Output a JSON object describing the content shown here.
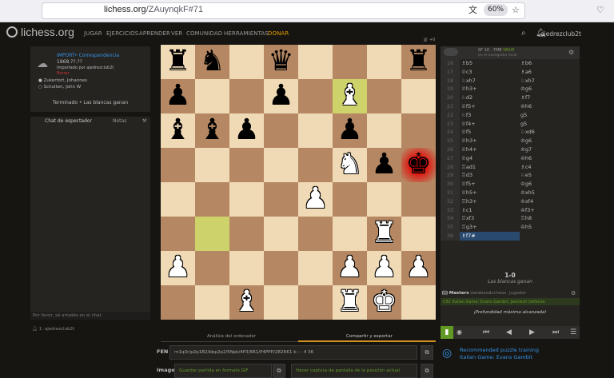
{
  "browser": {
    "url_domain": "lichess.org",
    "url_path": "/ZAuynqkF#71",
    "zoom": "60%"
  },
  "header": {
    "logo": "lichess.org",
    "nav": [
      "JUGAR",
      "EJERCICIOS",
      "APRENDER",
      "VER",
      "COMUNIDAD",
      "HERRAMIENTAS",
      "DONAR"
    ],
    "user": "ajedrezclub2t",
    "colors": {
      "accent": "#e69f00"
    }
  },
  "game_info": {
    "import_label": "IMPORT",
    "mode": "Correspondencia",
    "rating": "1868.??.??",
    "imported_by": "Importado por ajedrezclub2t",
    "tag": "Borrar",
    "white": "Zukertort, Johannes",
    "black": "Schulten, John W",
    "status": "Terminado • Las blancas ganan"
  },
  "chat": {
    "tab_chat": "Chat de espectador",
    "tab_notes": "Notas",
    "placeholder": "Por favor, sé amable en el chat",
    "spectators": "1: ajedrezclub2t"
  },
  "ceval": {
    "engine": "SF 16 · 7MB",
    "engine_tag": "NNUE",
    "sub": "en el navegador local"
  },
  "moves": [
    {
      "n": "16",
      "w": "♗b5",
      "b": "♗b6"
    },
    {
      "n": "17",
      "w": "♕c3",
      "b": "♗a6"
    },
    {
      "n": "18",
      "w": "♘xh7",
      "b": "♘xh7"
    },
    {
      "n": "19",
      "w": "♕h3+",
      "b": "♔g6"
    },
    {
      "n": "20",
      "w": "♘d2",
      "b": "♗f7"
    },
    {
      "n": "21",
      "w": "♕f5+",
      "b": "♔h6"
    },
    {
      "n": "22",
      "w": "♘f3",
      "b": "g5"
    },
    {
      "n": "23",
      "w": "♕f4+",
      "b": "g5"
    },
    {
      "n": "24",
      "w": "♕f5",
      "b": "♘xd6"
    },
    {
      "n": "25",
      "w": "♕h3+",
      "b": "♔g6"
    },
    {
      "n": "26",
      "w": "♕h4+",
      "b": "♔g7"
    },
    {
      "n": "27",
      "w": "♕g4",
      "b": "♔h6"
    },
    {
      "n": "28",
      "w": "♖ad1",
      "b": "♗c4"
    },
    {
      "n": "29",
      "w": "♖d3",
      "b": "♘e5"
    },
    {
      "n": "30",
      "w": "♕f5+",
      "b": "♔g6"
    },
    {
      "n": "31",
      "w": "♕h5+",
      "b": "♔xh5"
    },
    {
      "n": "32",
      "w": "♖h3+",
      "b": "♔xf4"
    },
    {
      "n": "33",
      "w": "♗c1",
      "b": "♔f3+"
    },
    {
      "n": "34",
      "w": "♖xf3",
      "b": "♖h8"
    },
    {
      "n": "35",
      "w": "♖g3+",
      "b": "♔h5"
    },
    {
      "n": "36",
      "w": "♗f7#",
      "b": ""
    }
  ],
  "result": {
    "score": "1-0",
    "text": "Las blancas ganan"
  },
  "explorer": {
    "title": "Masters",
    "db": "database",
    "tab_lichess": "Lichess",
    "tab_player": "Jugador",
    "opening": "C52 Italian Game: Evans Gambit, Jaenisch Defense",
    "max_depth": "¡Profundidad máxima alcanzada!"
  },
  "puzzle": {
    "line1": "Recommended puzzle training",
    "line2": "Italian Game: Evans Gambit"
  },
  "underboard": {
    "tab_analysis": "Análisis del ordenador",
    "tab_share": "Compartir y exportar",
    "fen_label": "FEN",
    "fen_value": "rn1q3r/p2p1B2/bbp2p2/5Npk/4P3/6R1/P4PPP/2B2RK1 b - - 4 36",
    "image_label": "Image",
    "gif_label": "Guardar partida en formato GIF",
    "screenshot_label": "Hacer captura de pantalla de la posición actual"
  },
  "counts": {
    "plus": "+0"
  }
}
